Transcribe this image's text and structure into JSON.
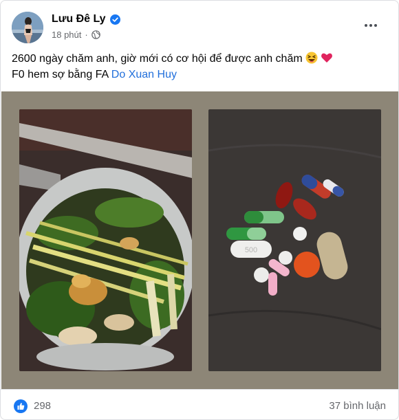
{
  "post": {
    "author_name": "Lưu Đê Ly",
    "timestamp": "18 phút",
    "caption_line1": "2600 ngày chăm anh, giờ mới có cơ hội để được anh chăm",
    "caption_line2_prefix": "F0 hem sợ bằng FA",
    "mention": "Do Xuan Huy",
    "reaction_count": "298",
    "comment_count": "37 bình luận"
  },
  "photos": [
    {
      "subject": "pot of boiling herbs"
    },
    {
      "subject": "pills on dark cloth",
      "pill_imprint": "500"
    }
  ],
  "colors": {
    "verified_blue": "#1877f2",
    "mention_blue": "#216fdb",
    "secondary_text": "#65676b",
    "photo_background": "#8d8677"
  },
  "icons": [
    "verified-badge-icon",
    "globe-icon",
    "more-options-icon",
    "laughing-emoji-icon",
    "red-heart-icon",
    "like-reaction-icon"
  ]
}
